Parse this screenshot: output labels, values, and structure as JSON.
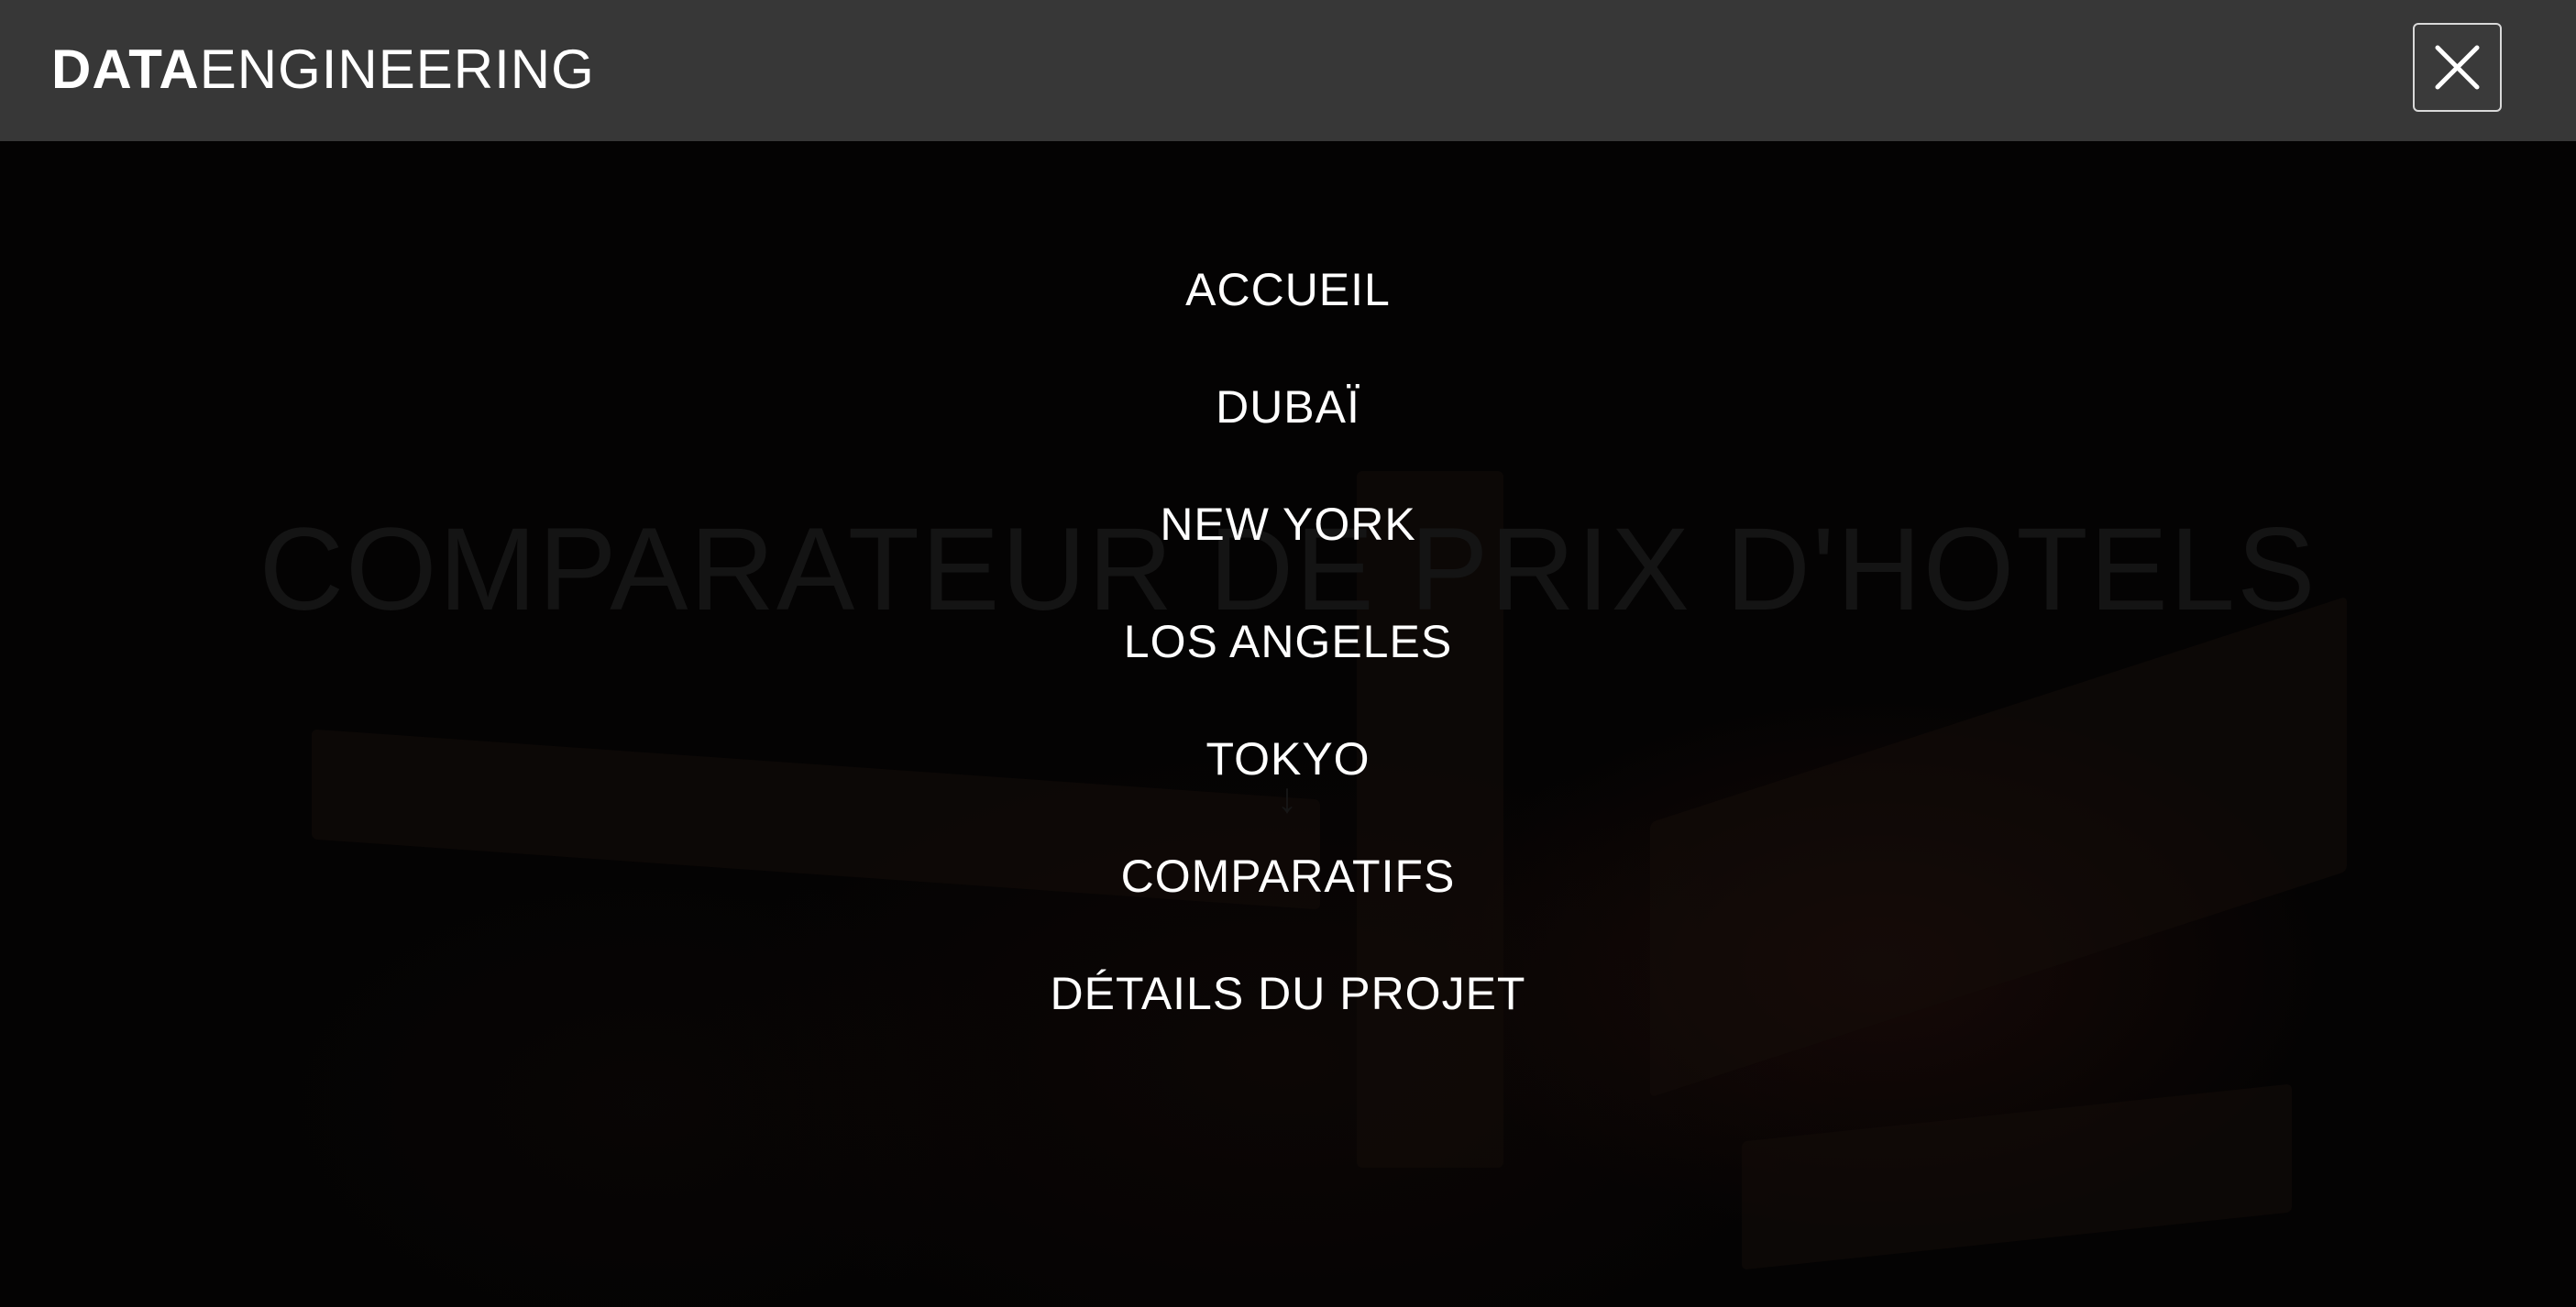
{
  "header": {
    "brand_bold": "DATA",
    "brand_light": "ENGINEERING",
    "close_icon": "close-icon"
  },
  "hero": {
    "title": "COMPARATEUR DE PRIX D'HOTELS",
    "scroll_icon": "arrow-down-icon"
  },
  "menu": {
    "items": [
      {
        "label": "ACCUEIL"
      },
      {
        "label": "DUBAÏ"
      },
      {
        "label": "NEW YORK"
      },
      {
        "label": "LOS ANGELES"
      },
      {
        "label": "TOKYO"
      },
      {
        "label": "COMPARATIFS"
      },
      {
        "label": "DÉTAILS DU PROJET"
      }
    ]
  },
  "colors": {
    "header_bg": "#373737",
    "overlay_bg": "#030303",
    "text": "#ffffff"
  }
}
